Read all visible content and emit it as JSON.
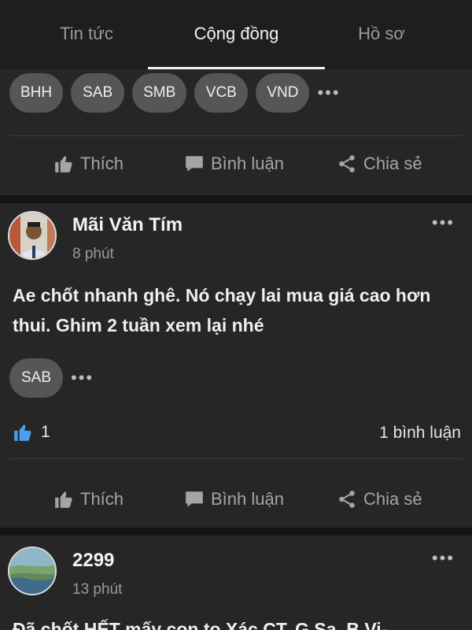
{
  "tabs": [
    {
      "label": "Tin tức",
      "active": false
    },
    {
      "label": "Cộng đồng",
      "active": true
    },
    {
      "label": "Hồ sơ",
      "active": false
    }
  ],
  "actions": {
    "like_label": "Thích",
    "comment_label": "Bình luận",
    "share_label": "Chia sẻ"
  },
  "posts": [
    {
      "chips": [
        "BHH",
        "SAB",
        "SMB",
        "VCB",
        "VND"
      ]
    },
    {
      "author": "Mãi Văn Tím",
      "time": "8 phút",
      "content": "Ae chốt nhanh ghê. Nó chạy lai mua giá cao hơn thui. Ghim 2 tuần xem lại nhé",
      "chips": [
        "SAB"
      ],
      "like_count": "1",
      "comment_count": "1 bình luận"
    },
    {
      "author": "2299",
      "time": "13 phút",
      "content": "Đã chốt HẾT mấy con to Xác CT, G Sa, B Vi-"
    }
  ],
  "icons": {
    "like": "thumbs-up-icon",
    "comment": "comment-icon",
    "share": "share-icon",
    "more": "more-horizontal-icon"
  },
  "colors": {
    "background": "#151515",
    "card": "#262626",
    "chip": "#565656",
    "like_active": "#4a9eea"
  }
}
